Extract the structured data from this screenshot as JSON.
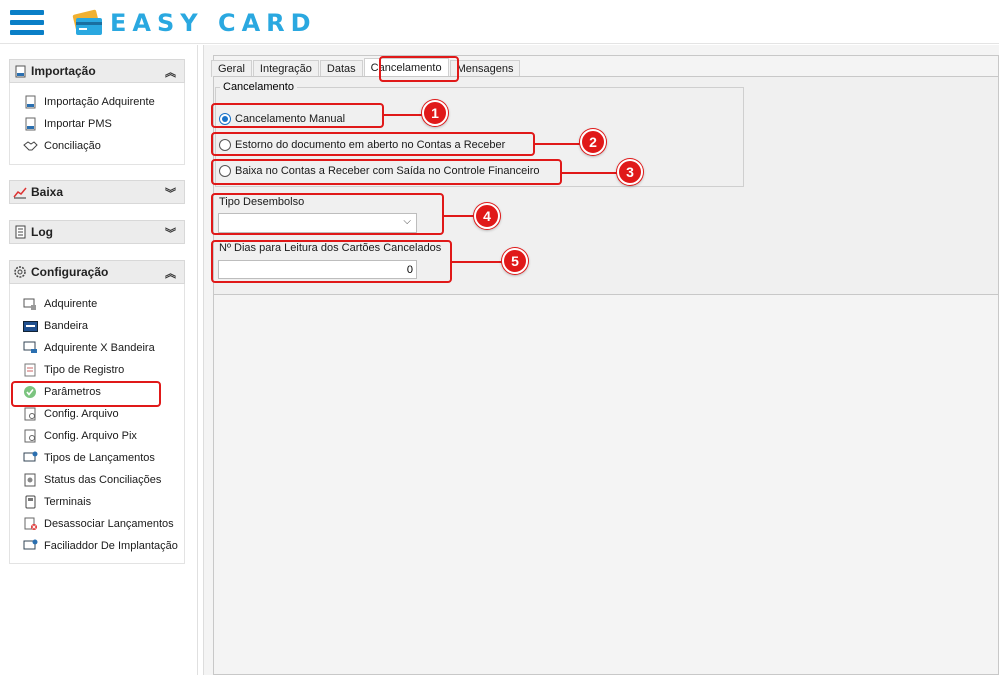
{
  "header": {
    "logo_text": "EASY CARD"
  },
  "sidebar": {
    "sections": {
      "importacao": {
        "label": "Importação",
        "items": [
          "Importação Adquirente",
          "Importar PMS",
          "Conciliação"
        ]
      },
      "baixa": {
        "label": "Baixa"
      },
      "log": {
        "label": "Log"
      },
      "configuracao": {
        "label": "Configuração",
        "items": [
          "Adquirente",
          "Bandeira",
          "Adquirente X Bandeira",
          "Tipo de Registro",
          "Parâmetros",
          "Config. Arquivo",
          "Config. Arquivo Pix",
          "Tipos de Lançamentos",
          "Status das Conciliações",
          "Terminais",
          "Desassociar Lançamentos",
          "Faciliaddor De Implantação"
        ]
      }
    }
  },
  "tabs": [
    "Geral",
    "Integração",
    "Datas",
    "Cancelamento",
    "Mensagens"
  ],
  "active_tab": "Cancelamento",
  "cancelamento": {
    "group_title": "Cancelamento",
    "options": [
      {
        "label": "Cancelamento Manual",
        "checked": true
      },
      {
        "label": "Estorno do documento em aberto no Contas a Receber",
        "checked": false
      },
      {
        "label": "Baixa no Contas a Receber com Saída no Controle Financeiro",
        "checked": false
      }
    ],
    "tipo_desembolso_label": "Tipo Desembolso",
    "tipo_desembolso_value": "",
    "dias_label": "Nº Dias para Leitura dos Cartões Cancelados",
    "dias_value": "0"
  },
  "callouts": [
    "1",
    "2",
    "3",
    "4",
    "5"
  ],
  "colors": {
    "accent": "#0a7fc7",
    "logo": "#2aa8e0",
    "highlight": "#e01919"
  }
}
